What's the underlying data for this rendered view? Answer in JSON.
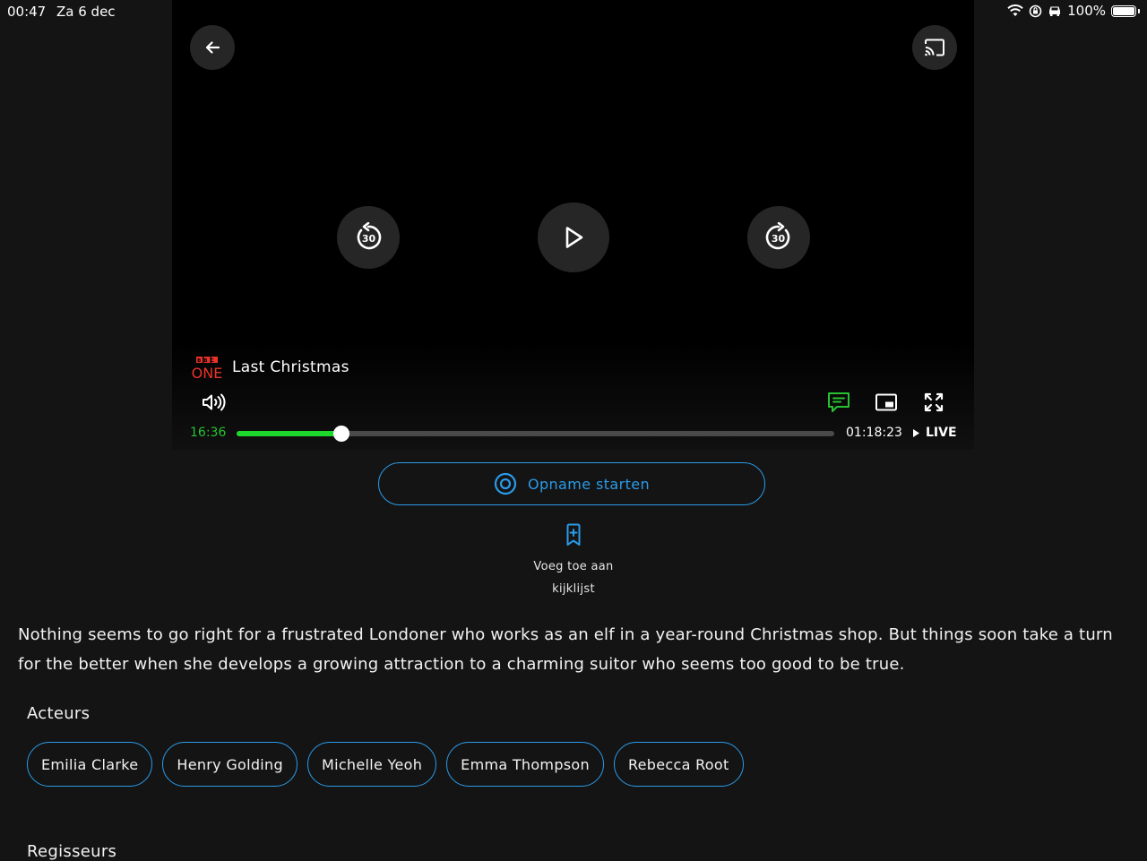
{
  "status_bar": {
    "time": "00:47",
    "date": "Za 6 dec",
    "battery": "100%",
    "icons": [
      "wifi-icon",
      "orientation-lock-icon",
      "car-icon",
      "battery-icon"
    ]
  },
  "player": {
    "channel_logo_top": "BBC",
    "channel_logo_bottom": "ONE",
    "program_title": "Last Christmas",
    "rewind_label": "30",
    "forward_label": "30",
    "time_elapsed": "16:36",
    "time_total": "01:18:23",
    "live_label": "LIVE",
    "progress_fraction": 0.175,
    "icons": [
      "back-arrow-icon",
      "cast-icon",
      "rewind-30-icon",
      "play-icon",
      "forward-30-icon",
      "volume-icon",
      "subtitles-icon",
      "picture-in-picture-icon",
      "fullscreen-icon"
    ]
  },
  "actions": {
    "record_label": "Opname starten",
    "watchlist_line1": "Voeg toe aan",
    "watchlist_line2": "kijklijst"
  },
  "description": "Nothing seems to go right for a frustrated Londoner who works as an elf in a year-round Christmas shop. But things soon take a turn for the better when she develops a growing attraction to a charming suitor who seems too good to be true.",
  "cast": {
    "heading": "Acteurs",
    "actors": [
      "Emilia Clarke",
      "Henry Golding",
      "Michelle Yeoh",
      "Emma Thompson",
      "Rebecca Root"
    ]
  },
  "directors": {
    "heading": "Regisseurs"
  },
  "colors": {
    "background": "#141414",
    "accent_blue": "#2a9be8",
    "progress_green": "#1fd82e",
    "channel_red": "#e8332a"
  }
}
